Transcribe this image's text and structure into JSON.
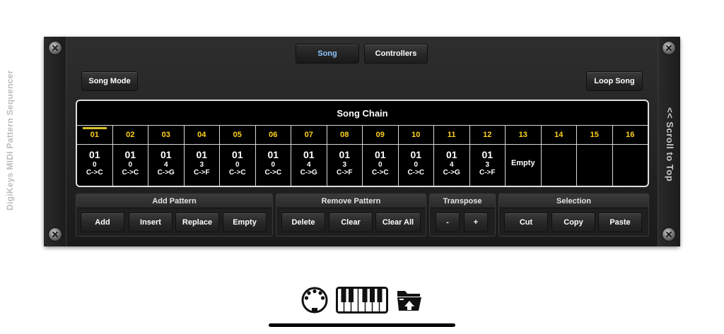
{
  "app": {
    "side_title": "DigiKeys MIDI Pattern Sequencer",
    "scroll_label": "<< Scroll to Top"
  },
  "tabs": [
    {
      "label": "Song",
      "active": true
    },
    {
      "label": "Controllers",
      "active": false
    }
  ],
  "buttons": {
    "song_mode": "Song Mode",
    "loop_song": "Loop Song"
  },
  "chain": {
    "title": "Song Chain",
    "selected_index": "01",
    "slots": [
      {
        "index": "01",
        "pattern": "01",
        "transpose": "0",
        "notes": "C->C"
      },
      {
        "index": "02",
        "pattern": "01",
        "transpose": "0",
        "notes": "C->C"
      },
      {
        "index": "03",
        "pattern": "01",
        "transpose": "4",
        "notes": "C->G"
      },
      {
        "index": "04",
        "pattern": "01",
        "transpose": "3",
        "notes": "C->F"
      },
      {
        "index": "05",
        "pattern": "01",
        "transpose": "0",
        "notes": "C->C"
      },
      {
        "index": "06",
        "pattern": "01",
        "transpose": "0",
        "notes": "C->C"
      },
      {
        "index": "07",
        "pattern": "01",
        "transpose": "4",
        "notes": "C->G"
      },
      {
        "index": "08",
        "pattern": "01",
        "transpose": "3",
        "notes": "C->F"
      },
      {
        "index": "09",
        "pattern": "01",
        "transpose": "0",
        "notes": "C->C"
      },
      {
        "index": "10",
        "pattern": "01",
        "transpose": "0",
        "notes": "C->C"
      },
      {
        "index": "11",
        "pattern": "01",
        "transpose": "4",
        "notes": "C->G"
      },
      {
        "index": "12",
        "pattern": "01",
        "transpose": "3",
        "notes": "C->F"
      },
      {
        "index": "13",
        "empty": "Empty"
      },
      {
        "index": "14"
      },
      {
        "index": "15"
      },
      {
        "index": "16"
      }
    ]
  },
  "groups": {
    "add_pattern": {
      "title": "Add Pattern",
      "buttons": [
        "Add",
        "Insert",
        "Replace",
        "Empty"
      ]
    },
    "remove_pattern": {
      "title": "Remove Pattern",
      "buttons": [
        "Delete",
        "Clear",
        "Clear All"
      ]
    },
    "transpose": {
      "title": "Transpose",
      "buttons": [
        "-",
        "+"
      ]
    },
    "selection": {
      "title": "Selection",
      "buttons": [
        "Cut",
        "Copy",
        "Paste"
      ]
    }
  },
  "dock": {
    "icons": [
      "midi-connector-icon",
      "piano-keyboard-icon",
      "folder-icon"
    ]
  }
}
